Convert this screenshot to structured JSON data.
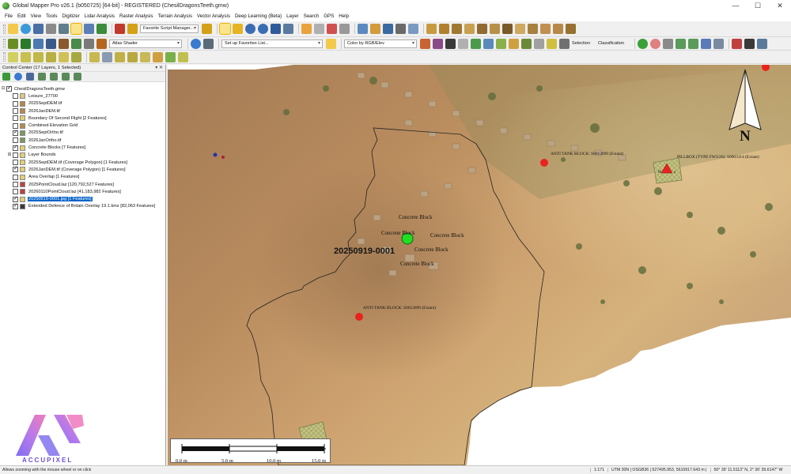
{
  "window": {
    "title": "Global Mapper Pro v26.1 (b050725) [64-bit] - REGISTERED (ChesilDragonsTeeth.gmw)",
    "minimize_glyph": "—",
    "maximize_glyph": "☐",
    "close_glyph": "✕"
  },
  "menu": [
    "File",
    "Edit",
    "View",
    "Tools",
    "Digitizer",
    "Lidar Analysis",
    "Raster Analysis",
    "Terrain Analysis",
    "Vector Analysis",
    "Deep Learning (Beta)",
    "Layer",
    "Search",
    "GPS",
    "Help"
  ],
  "toolbar": {
    "script_combo": "Favorite Script Manager...",
    "shader_combo": "Atlas Shader",
    "favorites_combo": "Set up Favorites List...",
    "color_combo": "Color by RGB/Elev",
    "selection_label": "Selection",
    "classification_label": "Classification"
  },
  "control_center": {
    "title": "Control Center (17 Layers, 1 Selected)",
    "header_buttons": "▾ ✕",
    "root": "ChesilDragonsTeeth.gmw",
    "layers": [
      {
        "label": "Leisure_27700",
        "checked": false,
        "selected": false,
        "expandable": false,
        "icon_color": "#d9c98a"
      },
      {
        "label": "2025SeptDEM.tif",
        "checked": false,
        "selected": false,
        "expandable": false,
        "icon_color": "#b58a4a"
      },
      {
        "label": "2026JanDEM.tif",
        "checked": false,
        "selected": false,
        "expandable": false,
        "icon_color": "#b58a4a"
      },
      {
        "label": "Boundary Of Second Flight [2 Features]",
        "checked": false,
        "selected": false,
        "expandable": false,
        "icon_color": "#e0d070"
      },
      {
        "label": "Combined Elevation Grid",
        "checked": false,
        "selected": false,
        "expandable": false,
        "icon_color": "#b58a4a"
      },
      {
        "label": "2025SeptOrtho.tif",
        "checked": true,
        "selected": false,
        "expandable": false,
        "icon_color": "#7a9a5a"
      },
      {
        "label": "2026JanOrtho.tif",
        "checked": false,
        "selected": false,
        "expandable": false,
        "icon_color": "#7a9a5a"
      },
      {
        "label": "Concrete Blocks [7 Features]",
        "checked": true,
        "selected": false,
        "expandable": false,
        "icon_color": "#e0d070"
      },
      {
        "label": "Layer Bounds",
        "checked": false,
        "selected": false,
        "expandable": true,
        "icon_color": "#e0d070"
      },
      {
        "label": "2025SeptDEM.tif (Coverage Polygon) [1 Features]",
        "checked": false,
        "selected": false,
        "expandable": false,
        "icon_color": "#e0d070"
      },
      {
        "label": "2026JanDEM.tif (Coverage Polygon) [1 Features]",
        "checked": true,
        "selected": false,
        "expandable": false,
        "icon_color": "#e0d070"
      },
      {
        "label": "Area Overlap [1 Features]",
        "checked": false,
        "selected": false,
        "expandable": false,
        "icon_color": "#e0d070"
      },
      {
        "label": "2025PointCloud.laz [120,792,527 Features]",
        "checked": false,
        "selected": false,
        "expandable": false,
        "icon_color": "#c04040"
      },
      {
        "label": "20260110PointCloud.laz [41,183,982 Features]",
        "checked": false,
        "selected": false,
        "expandable": false,
        "icon_color": "#c04040"
      },
      {
        "label": "20250919-0001.jpg [1 Features]",
        "checked": true,
        "selected": true,
        "expandable": false,
        "icon_color": "#e0d070"
      },
      {
        "label": "Extended Defence of Britain Overlay 19.1.kmz [82,063 Features]",
        "checked": true,
        "selected": false,
        "expandable": false,
        "icon_color": "#3a3a3a"
      }
    ]
  },
  "map": {
    "labels": {
      "block_1": "Concrete Block",
      "block_2": "Concrete Block",
      "block_3": "Concrete Block",
      "block_4": "Concrete Block",
      "block_5": "Concrete Block",
      "photo": "20250919-0001",
      "anti_tank_1": "ANTI TANK BLOCK: S0012099 (Extant)",
      "anti_tank_2": "ANTI TANK BLOCK: S0012099 (Extant)",
      "pillbox": "PILLBOX (TYPE FW3/26): S0003114 (Extant)",
      "pillbox_short": "Pi",
      "pillbox_short_2": "s",
      "north": "N"
    },
    "scale_ticks": [
      "0.0 m",
      "5.0 m",
      "10.0 m",
      "15.0 m"
    ],
    "colors": {
      "terrain_light": "#d6b07a",
      "terrain_dark": "#9b7650",
      "marker_red": "#e8231e",
      "photo_marker": "#22dd22"
    }
  },
  "status": {
    "hint": "Allows zooming with the mouse wheel or on click",
    "scale": "1:171",
    "projection": "UTM 30N | OSGB36 | 527495.953, 5610917.643 m |",
    "coords": "50° 39' 11.5113\" N, 2° 36' 39.6147\" W"
  },
  "logo": {
    "text": "ACCUPIXEL"
  }
}
